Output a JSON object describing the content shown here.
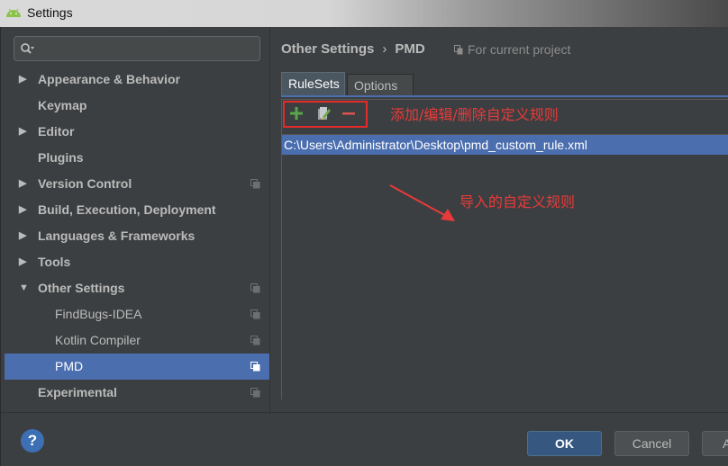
{
  "window": {
    "title": "Settings"
  },
  "search": {
    "placeholder": "",
    "value": ""
  },
  "tree": [
    {
      "label": "Appearance & Behavior",
      "arrow": "▶",
      "level": 0,
      "copy": false
    },
    {
      "label": "Keymap",
      "arrow": "",
      "level": 0,
      "copy": false
    },
    {
      "label": "Editor",
      "arrow": "▶",
      "level": 0,
      "copy": false
    },
    {
      "label": "Plugins",
      "arrow": "",
      "level": 0,
      "copy": false
    },
    {
      "label": "Version Control",
      "arrow": "▶",
      "level": 0,
      "copy": true
    },
    {
      "label": "Build, Execution, Deployment",
      "arrow": "▶",
      "level": 0,
      "copy": false
    },
    {
      "label": "Languages & Frameworks",
      "arrow": "▶",
      "level": 0,
      "copy": false
    },
    {
      "label": "Tools",
      "arrow": "▶",
      "level": 0,
      "copy": false
    },
    {
      "label": "Other Settings",
      "arrow": "▼",
      "level": 0,
      "copy": true
    },
    {
      "label": "FindBugs-IDEA",
      "arrow": "",
      "level": 1,
      "copy": true
    },
    {
      "label": "Kotlin Compiler",
      "arrow": "",
      "level": 1,
      "copy": true
    },
    {
      "label": "PMD",
      "arrow": "",
      "level": 1,
      "copy": true,
      "selected": true
    },
    {
      "label": "Experimental",
      "arrow": "",
      "level": 0,
      "copy": true
    }
  ],
  "breadcrumb": {
    "parent": "Other Settings",
    "separator": "›",
    "current": "PMD"
  },
  "scope": {
    "label": "For current project",
    "icon": "project-scope-icon"
  },
  "tabs": {
    "rulesets": "RuleSets",
    "options": "Options"
  },
  "toolbar": {
    "add_icon": "plus-icon",
    "edit_icon": "edit-icon",
    "remove_icon": "minus-icon"
  },
  "rulesets": [
    "C:\\Users\\Administrator\\Desktop\\pmd_custom_rule.xml"
  ],
  "annotations": {
    "toolbar_note": "添加/编辑/删除自定义规则",
    "list_note": "导入的自定义规则"
  },
  "buttons": {
    "help": "?",
    "ok": "OK",
    "cancel": "Cancel",
    "apply": "A"
  },
  "colors": {
    "selection": "#4b6eaf",
    "annotation_red": "#e32b2b",
    "add_green": "#57a64a"
  }
}
